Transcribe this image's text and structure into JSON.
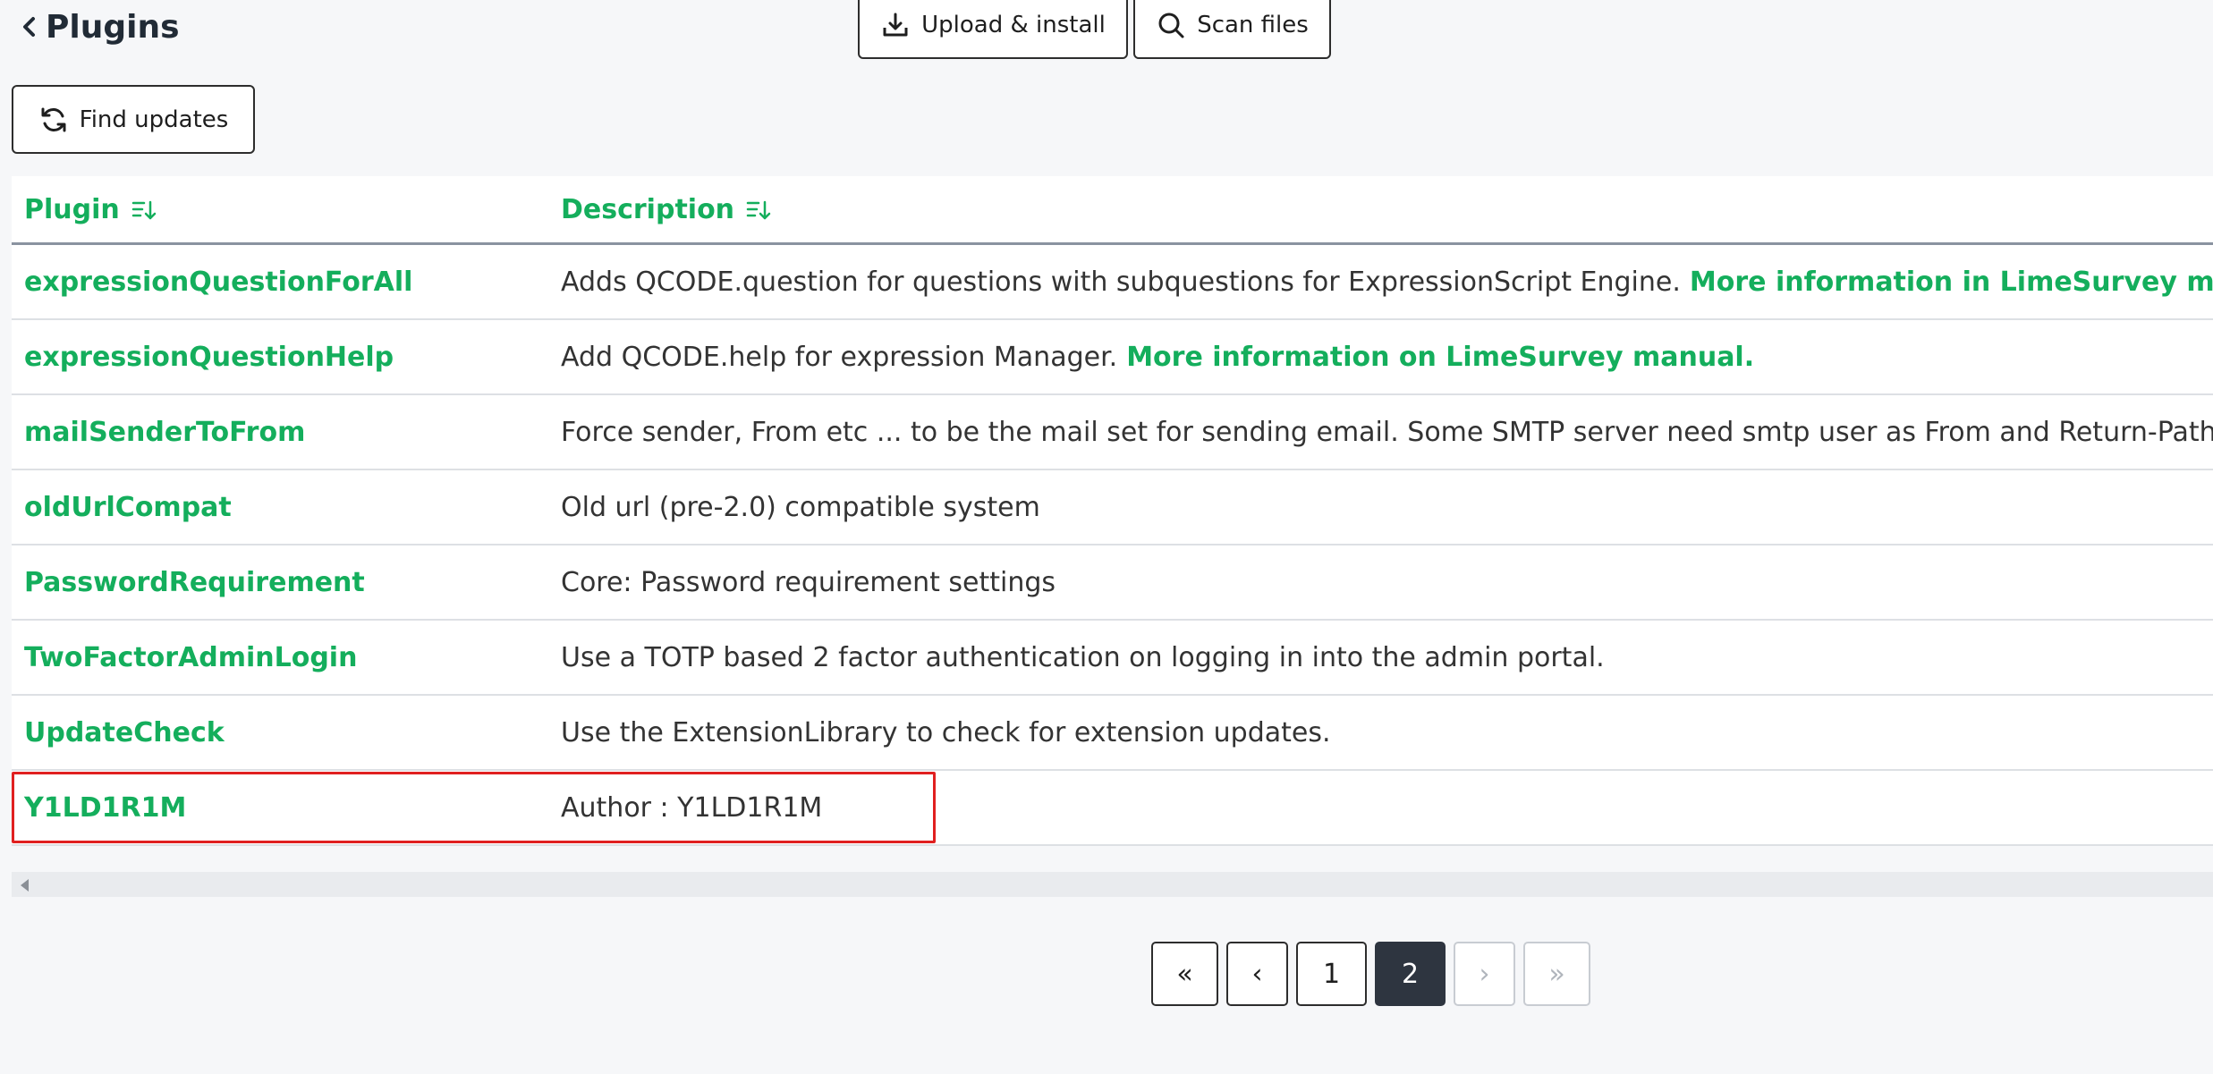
{
  "header": {
    "title": "Plugins",
    "upload_label": "Upload & install",
    "scan_label": "Scan files",
    "find_updates_label": "Find updates"
  },
  "table": {
    "columns": [
      "Plugin",
      "Description"
    ],
    "rows": [
      {
        "name": "expressionQuestionForAll",
        "description": "Adds QCODE.question for questions with subquestions for ExpressionScript Engine.",
        "link": "More information in LimeSurvey manual."
      },
      {
        "name": "expressionQuestionHelp",
        "description": "Add QCODE.help for expression Manager.",
        "link": "More information on LimeSurvey manual."
      },
      {
        "name": "mailSenderToFrom",
        "description": "Force sender, From etc ... to be the mail set for sending email. Some SMTP server need smtp user as From and Return-Path.",
        "link": ""
      },
      {
        "name": "oldUrlCompat",
        "description": "Old url (pre-2.0) compatible system",
        "link": ""
      },
      {
        "name": "PasswordRequirement",
        "description": "Core: Password requirement settings",
        "link": ""
      },
      {
        "name": "TwoFactorAdminLogin",
        "description": "Use a TOTP based 2 factor authentication on logging in into the admin portal.",
        "link": ""
      },
      {
        "name": "UpdateCheck",
        "description": "Use the ExtensionLibrary to check for extension updates.",
        "link": ""
      },
      {
        "name": "Y1LD1R1M",
        "description": "Author : Y1LD1R1M",
        "link": ""
      }
    ]
  },
  "pagination": {
    "first": "«",
    "prev": "‹",
    "pages": [
      "1",
      "2"
    ],
    "current": "2",
    "next": "›",
    "last": "»"
  },
  "colors": {
    "accent": "#14ae5c",
    "highlight": "#e02020",
    "active_page": "#2e3540"
  }
}
